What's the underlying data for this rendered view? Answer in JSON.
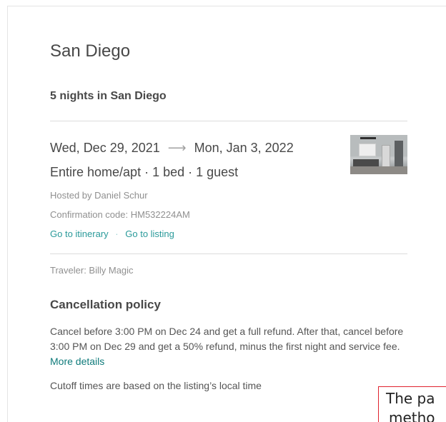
{
  "trip": {
    "city": "San Diego",
    "nights_title": "5 nights in San Diego",
    "check_in": "Wed, Dec 29, 2021",
    "arrow": "⟶",
    "check_out": "Mon, Jan 3, 2022",
    "summary": "Entire home/apt · 1 bed · 1 guest",
    "host": "Hosted by Daniel Schur",
    "confirmation": "Confirmation code: HM532224AM",
    "links": {
      "itinerary": "Go to itinerary",
      "separator": "·",
      "listing": "Go to listing"
    },
    "traveler": "Traveler: Billy Magic",
    "thumbnail_icon": "listing-photo-kitchen"
  },
  "cancellation": {
    "title": "Cancellation policy",
    "body": "Cancel before 3:00 PM on Dec 24 and get a full refund. After that, cancel before 3:00 PM on Dec 29 and get a 50% refund, minus the first night and service fee.",
    "more_details": "More details",
    "cutoff": "Cutoff times are based on the listing’s local time"
  },
  "tooltip": {
    "line1": "The pa",
    "line2": "metho"
  },
  "colors": {
    "link": "#2a9a9a",
    "more_details": "#0f7b7b",
    "tooltip_border": "#e0222e",
    "text": "#484848"
  }
}
